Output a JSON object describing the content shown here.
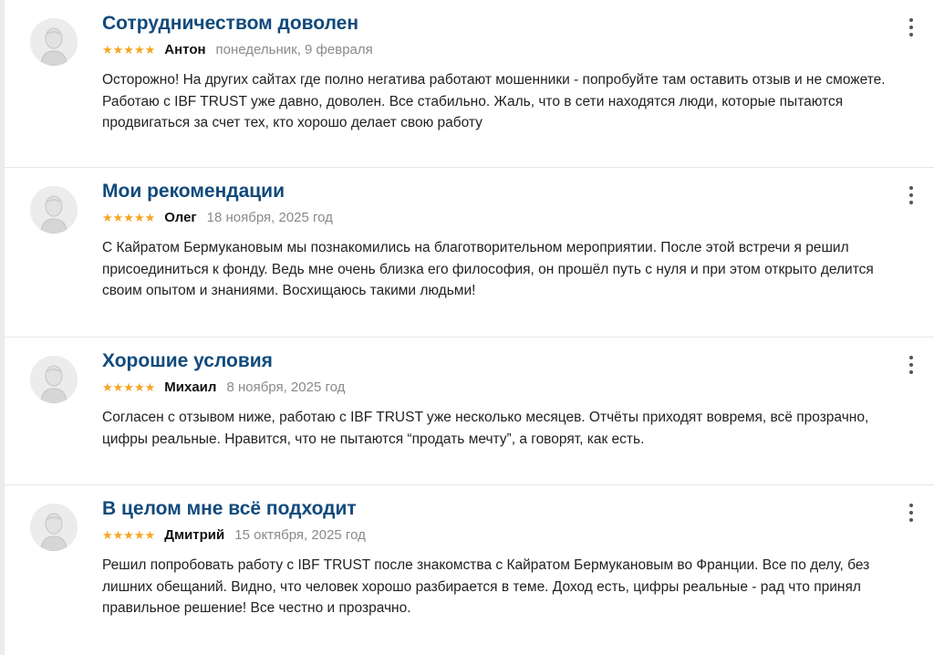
{
  "reviews": [
    {
      "title": "Сотрудничеством доволен",
      "stars": "★★★★★",
      "author": "Антон",
      "date": "понедельник, 9 февраля",
      "text": "Осторожно! На других сайтах где полно негатива работают мошенники - попробуйте там оставить отзыв и не сможете. Работаю с IBF TRUST уже давно, доволен. Все стабильно. Жаль, что в сети находятся люди, которые пытаются продвигаться за счет тех, кто хорошо делает свою работу",
      "rating": 5
    },
    {
      "title": "Мои рекомендации",
      "stars": "★★★★★",
      "author": "Олег",
      "date": "18 ноября, 2025 год",
      "text": "С Кайратом Бермукановым мы познакомились на благотворительном мероприятии. После этой встречи я решил присоединиться к фонду. Ведь мне очень близка его философия, он прошёл путь с нуля и при этом открыто делится своим опытом и знаниями. Восхищаюсь такими людьми!",
      "rating": 5
    },
    {
      "title": "Хорошие условия",
      "stars": "★★★★★",
      "author": "Михаил",
      "date": "8 ноября, 2025 год",
      "text": "Согласен с отзывом ниже, работаю с IBF TRUST уже несколько месяцев. Отчёты приходят вовремя, всё прозрачно, цифры реальные. Нравится, что не пытаются “продать мечту”, а говорят, как есть.",
      "rating": 5
    },
    {
      "title": "В целом мне всё подходит",
      "stars": "★★★★★",
      "author": "Дмитрий",
      "date": "15 октября, 2025 год",
      "text": "Решил попробовать работу с IBF TRUST после знакомства с Кайратом Бермукановым во Франции. Все по делу, без лишних обещаний. Видно, что человек хорошо разбирается в теме. Доход есть, цифры реальные - рад что принял правильное решение! Все честно и прозрачно.",
      "rating": 5
    }
  ],
  "colors": {
    "title": "#114a7c",
    "star": "#f5a623",
    "date": "#8a8a8a",
    "avatar_bg": "#ececec"
  },
  "icons": {
    "avatar": "user-avatar-icon",
    "menu": "more-vertical-icon"
  }
}
